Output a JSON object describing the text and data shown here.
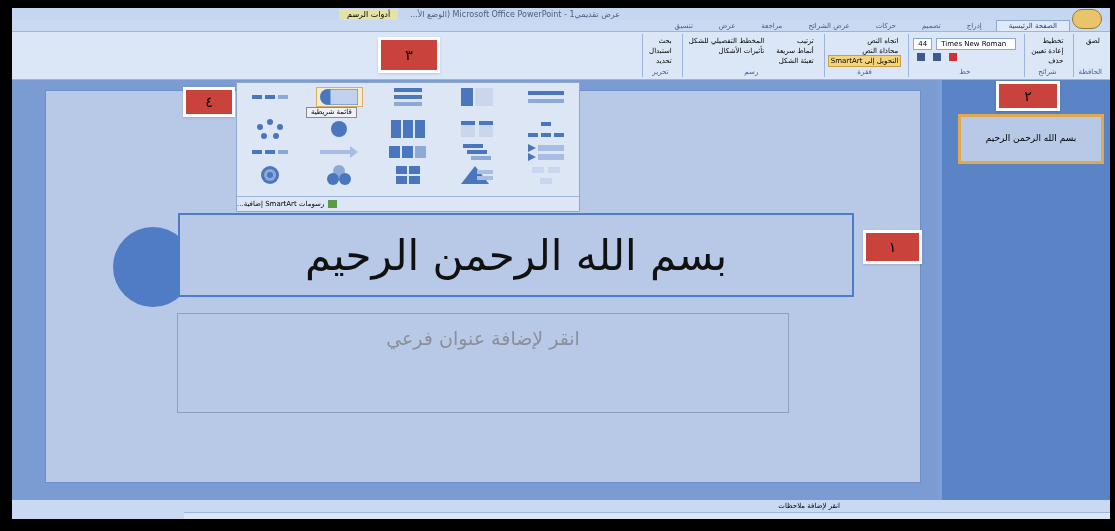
{
  "window": {
    "title": "عرض تقديمي1 - Microsoft Office PowerPoint (الوضع الأ...",
    "context_tab": "أدوات الرسم"
  },
  "tabs": [
    {
      "label": "الصفحة الرئيسية",
      "selected": true
    },
    {
      "label": "إدراج",
      "selected": false
    },
    {
      "label": "تصميم",
      "selected": false
    },
    {
      "label": "حركات",
      "selected": false
    },
    {
      "label": "عرض الشرائح",
      "selected": false
    },
    {
      "label": "مراجعة",
      "selected": false
    },
    {
      "label": "عرض",
      "selected": false
    },
    {
      "label": "تنسيق",
      "selected": false
    }
  ],
  "ribbon": {
    "groups": [
      {
        "kind": "buttons",
        "label": "الحافظة",
        "buttons": [
          "لصق"
        ]
      },
      {
        "kind": "buttons",
        "label": "شرائح",
        "buttons": [
          "تخطيط",
          "إعادة تعيين",
          "حذف"
        ]
      },
      {
        "kind": "font",
        "label": "خط",
        "font": "Times New Roman",
        "size": "44"
      },
      {
        "kind": "buttons",
        "label": "فقرة",
        "buttons": [
          "اتجاه النص",
          "محاذاة النص",
          "التحويل إلى SmartArt"
        ]
      },
      {
        "kind": "buttons",
        "label": "رسم",
        "buttons": [
          "ترتيب",
          "أنماط سريعة",
          "تعبئة الشكل",
          "المخطط التفصيلي للشكل",
          "تأثيرات الأشكال"
        ]
      },
      {
        "kind": "buttons",
        "label": "تحرير",
        "buttons": [
          "بحث",
          "استبدال",
          "تحديد"
        ]
      }
    ]
  },
  "smartart_gallery": {
    "layouts": [
      {
        "kind": "process",
        "selected": false
      },
      {
        "kind": "list",
        "selected": true
      },
      {
        "kind": "stack",
        "selected": false
      },
      {
        "kind": "table",
        "selected": false
      },
      {
        "kind": "lines",
        "selected": false
      },
      {
        "kind": "cycle",
        "selected": false
      },
      {
        "kind": "radial",
        "selected": false
      },
      {
        "kind": "columns",
        "selected": false
      },
      {
        "kind": "boxes",
        "selected": false
      },
      {
        "kind": "hierarchy",
        "selected": false
      },
      {
        "kind": "process",
        "selected": false
      },
      {
        "kind": "arrow",
        "selected": false
      },
      {
        "kind": "blocks",
        "selected": false
      },
      {
        "kind": "stagger",
        "selected": false
      },
      {
        "kind": "chevron",
        "selected": false
      },
      {
        "kind": "target",
        "selected": false
      },
      {
        "kind": "venn",
        "selected": false
      },
      {
        "kind": "matrix",
        "selected": false
      },
      {
        "kind": "pyramid",
        "selected": false
      },
      {
        "kind": "org",
        "selected": false
      }
    ],
    "tooltip": "قائمة شريطية",
    "more": "رسومات SmartArt إضافية..."
  },
  "slide": {
    "title": "بسم الله الرحمن الرحيم",
    "subtitle_placeholder": "انقر لإضافة عنوان فرعي"
  },
  "thumbnails": [
    {
      "title": "بسم الله الرحمن الرحيم",
      "selected": true
    }
  ],
  "notes": {
    "placeholder": "انقر لإضافة ملاحظات"
  },
  "callouts": [
    {
      "label": "١"
    },
    {
      "label": "٢"
    },
    {
      "label": "٣"
    },
    {
      "label": "٤"
    }
  ]
}
